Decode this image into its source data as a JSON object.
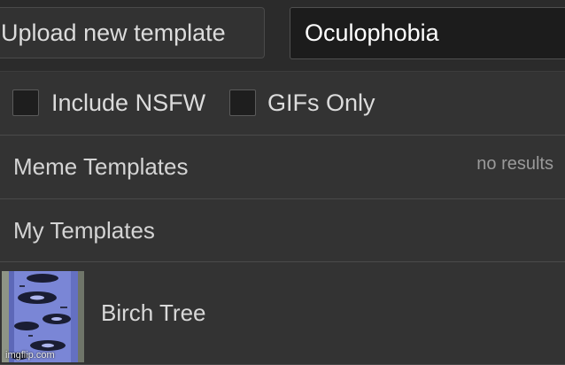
{
  "toolbar": {
    "upload_label": "Upload new template",
    "search_value": "Oculophobia"
  },
  "filters": {
    "nsfw_label": "Include NSFW",
    "nsfw_checked": false,
    "gifs_label": "GIFs Only",
    "gifs_checked": false
  },
  "sections": {
    "meme_templates": {
      "title": "Meme Templates",
      "status": "no results"
    },
    "my_templates": {
      "title": "My Templates",
      "items": [
        {
          "label": "Birch Tree",
          "watermark": "imgflip.com"
        }
      ]
    }
  },
  "colors": {
    "background": "#2b2b2b",
    "panel": "#333333",
    "input_bg": "#1c1c1c",
    "thumb_bark": "#7a86d6"
  }
}
